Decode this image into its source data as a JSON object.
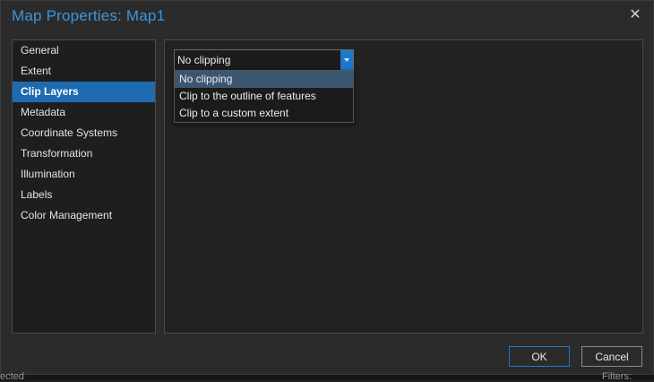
{
  "dialog": {
    "title": "Map Properties: Map1",
    "close_glyph": "✕"
  },
  "sidebar": {
    "items": [
      {
        "label": "General"
      },
      {
        "label": "Extent"
      },
      {
        "label": "Clip Layers",
        "selected": true
      },
      {
        "label": "Metadata"
      },
      {
        "label": "Coordinate Systems"
      },
      {
        "label": "Transformation"
      },
      {
        "label": "Illumination"
      },
      {
        "label": "Labels"
      },
      {
        "label": "Color Management"
      }
    ]
  },
  "clip": {
    "combo_value": "No clipping",
    "options": [
      {
        "label": "No clipping",
        "highlighted": true
      },
      {
        "label": "Clip to the outline of features"
      },
      {
        "label": "Clip to a custom extent"
      }
    ]
  },
  "footer": {
    "ok_label": "OK",
    "cancel_label": "Cancel"
  },
  "background_fragments": {
    "left": "ected",
    "right": "Filters:"
  },
  "colors": {
    "accent": "#1e78cc",
    "title": "#3e95dd",
    "selected_item": "#1f6bb0",
    "dropdown_highlight": "#3b5670"
  }
}
